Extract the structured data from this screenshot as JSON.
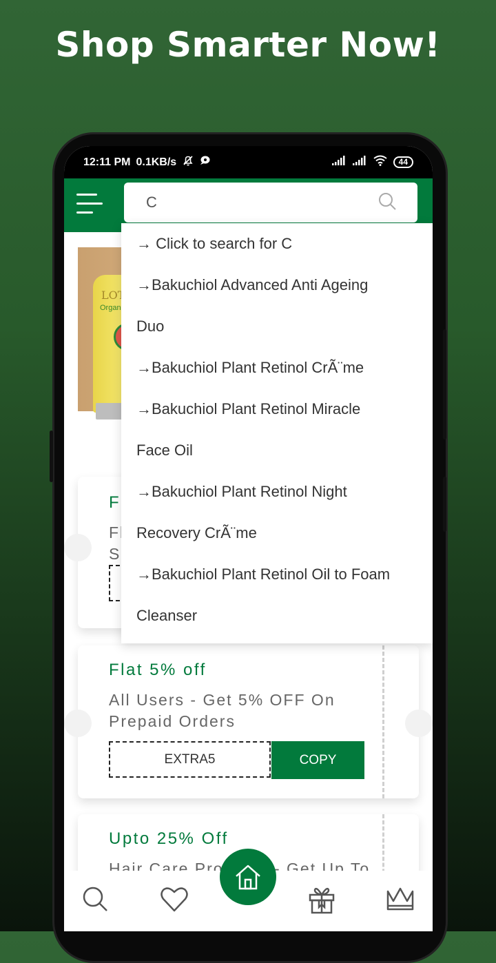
{
  "headline": "Shop Smarter Now!",
  "status_bar": {
    "time": "12:11 PM",
    "speed": "0.1KB/s",
    "battery": "44"
  },
  "search": {
    "value": "C",
    "placeholder": ""
  },
  "suggestions": [
    "→ Click to search for C",
    "→Bakuchiol Advanced Anti Ageing",
    "Duo",
    "→Bakuchiol Plant Retinol CrÃ¨me",
    "→Bakuchiol Plant Retinol Miracle",
    "Face Oil",
    "→Bakuchiol Plant Retinol Night",
    "Recovery CrÃ¨me",
    "→Bakuchiol Plant Retinol Oil to Foam",
    "Cleanser"
  ],
  "banner": {
    "brand": "LOTUS",
    "sub": "Organic"
  },
  "coupons": [
    {
      "title": "F",
      "desc_line1": "Fl",
      "desc_line2": "S",
      "code": "",
      "copy_label": ""
    },
    {
      "title": "Flat 5% off",
      "desc": "All Users - Get 5% OFF On Prepaid Orders",
      "code": "EXTRA5",
      "copy_label": "COPY"
    },
    {
      "title": "Upto 25% Off",
      "desc": "Hair Care Products - Get Up To"
    }
  ],
  "colors": {
    "brand_green": "#027a3c",
    "background_green": "#316535"
  },
  "bottom_nav": [
    {
      "icon": "search-icon"
    },
    {
      "icon": "heart-icon"
    },
    {
      "icon": "home-icon"
    },
    {
      "icon": "gift-icon"
    },
    {
      "icon": "crown-icon"
    }
  ]
}
